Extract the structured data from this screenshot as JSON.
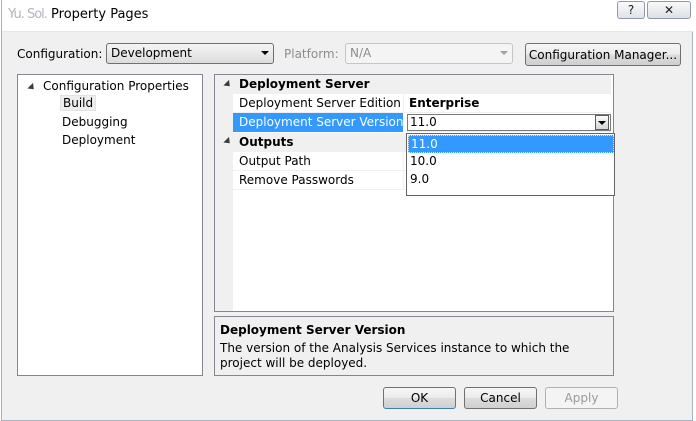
{
  "window": {
    "title_obscured": "Yu. Sol.",
    "title": "Property Pages",
    "help_label": "?",
    "close_label": "✕"
  },
  "config": {
    "configuration_label": "Configuration:",
    "configuration_value": "Development",
    "platform_label": "Platform:",
    "platform_value": "N/A",
    "manager_button": "Configuration Manager..."
  },
  "tree": {
    "root": "Configuration Properties",
    "items": [
      "Build",
      "Debugging",
      "Deployment"
    ],
    "selected": "Build"
  },
  "grid": {
    "categories": [
      {
        "name": "Deployment Server",
        "rows": [
          {
            "name": "Deployment Server Edition",
            "value": "Enterprise"
          },
          {
            "name": "Deployment Server Version",
            "value": "11.0"
          }
        ]
      },
      {
        "name": "Outputs",
        "rows": [
          {
            "name": "Output Path",
            "value": ""
          },
          {
            "name": "Remove Passwords",
            "value": ""
          }
        ]
      }
    ],
    "dropdown_options": [
      "11.0",
      "10.0",
      "9.0"
    ],
    "selected_option": "11.0"
  },
  "description": {
    "title": "Deployment Server Version",
    "text": "The version of the Analysis Services instance to which the project will be deployed."
  },
  "buttons": {
    "ok": "OK",
    "cancel": "Cancel",
    "apply": "Apply"
  },
  "colors": {
    "selection": "#3399ff",
    "frame": "#f0f0f0"
  }
}
